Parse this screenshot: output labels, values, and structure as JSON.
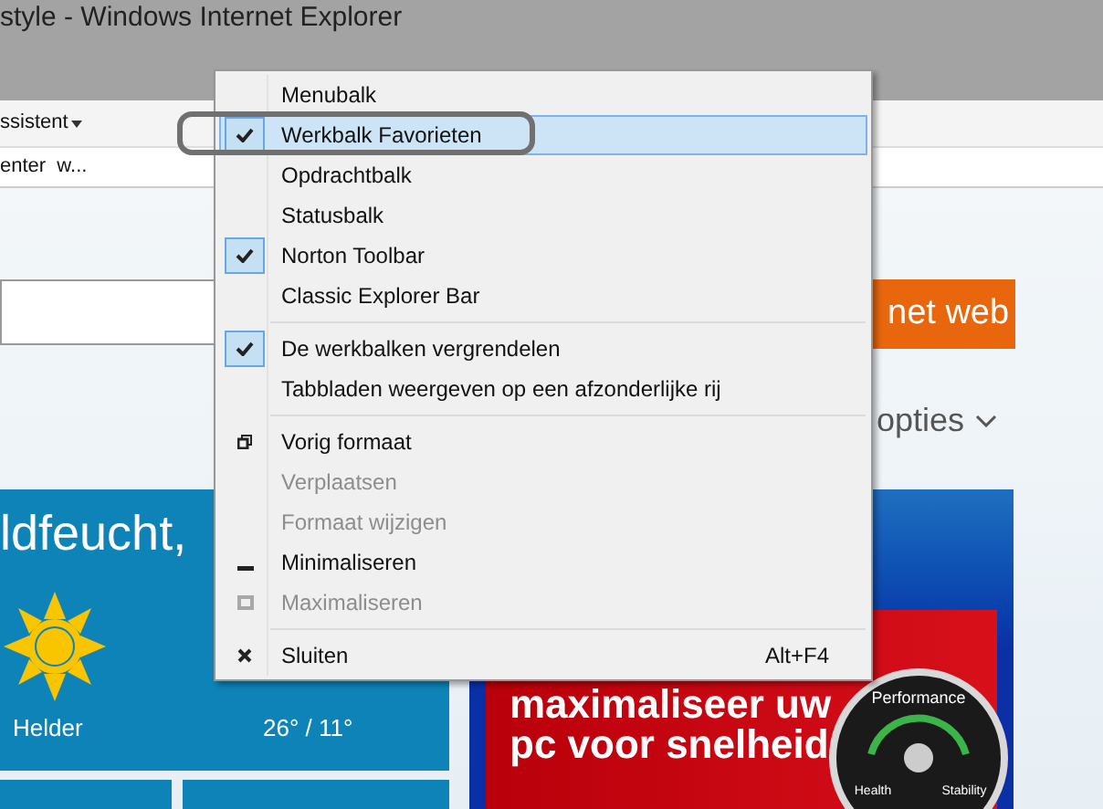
{
  "window": {
    "title": "style - Windows Internet Explorer"
  },
  "toolbar": {
    "menu_label": "ssistent",
    "favorite": "enter  w..."
  },
  "page": {
    "search_button": "net web",
    "options_link": "opties",
    "weather": {
      "heading": "ldfeucht,",
      "condition": "Helder",
      "temperature": "26° / 11°"
    },
    "ad": {
      "headline": "maximaliseer uw pc voor snelheid",
      "gauge_labels": [
        "Performance",
        "Health",
        "Stability"
      ]
    }
  },
  "context_menu": {
    "items": [
      {
        "kind": "toggle",
        "label": "Menubalk",
        "checked": false,
        "selected": false
      },
      {
        "kind": "toggle",
        "label": "Werkbalk Favorieten",
        "checked": true,
        "selected": true
      },
      {
        "kind": "toggle",
        "label": "Opdrachtbalk",
        "checked": false,
        "selected": false
      },
      {
        "kind": "toggle",
        "label": "Statusbalk",
        "checked": false,
        "selected": false
      },
      {
        "kind": "toggle",
        "label": "Norton Toolbar",
        "checked": true,
        "selected": false
      },
      {
        "kind": "toggle",
        "label": "Classic Explorer Bar",
        "checked": false,
        "selected": false
      },
      {
        "kind": "separator"
      },
      {
        "kind": "toggle",
        "label": "De werkbalken vergrendelen",
        "checked": true,
        "selected": false
      },
      {
        "kind": "toggle",
        "label": "Tabbladen weergeven op een afzonderlijke rij",
        "checked": false,
        "selected": false
      },
      {
        "kind": "separator"
      },
      {
        "kind": "restore",
        "label": "Vorig formaat",
        "disabled": false,
        "selected": false
      },
      {
        "kind": "move",
        "label": "Verplaatsen",
        "disabled": true,
        "selected": false
      },
      {
        "kind": "size",
        "label": "Formaat wijzigen",
        "disabled": true,
        "selected": false
      },
      {
        "kind": "minimize",
        "label": "Minimaliseren",
        "disabled": false,
        "selected": false
      },
      {
        "kind": "maximize",
        "label": "Maximaliseren",
        "disabled": true,
        "selected": false
      },
      {
        "kind": "separator"
      },
      {
        "kind": "close",
        "label": "Sluiten",
        "shortcut": "Alt+F4",
        "disabled": false,
        "selected": false
      }
    ]
  }
}
